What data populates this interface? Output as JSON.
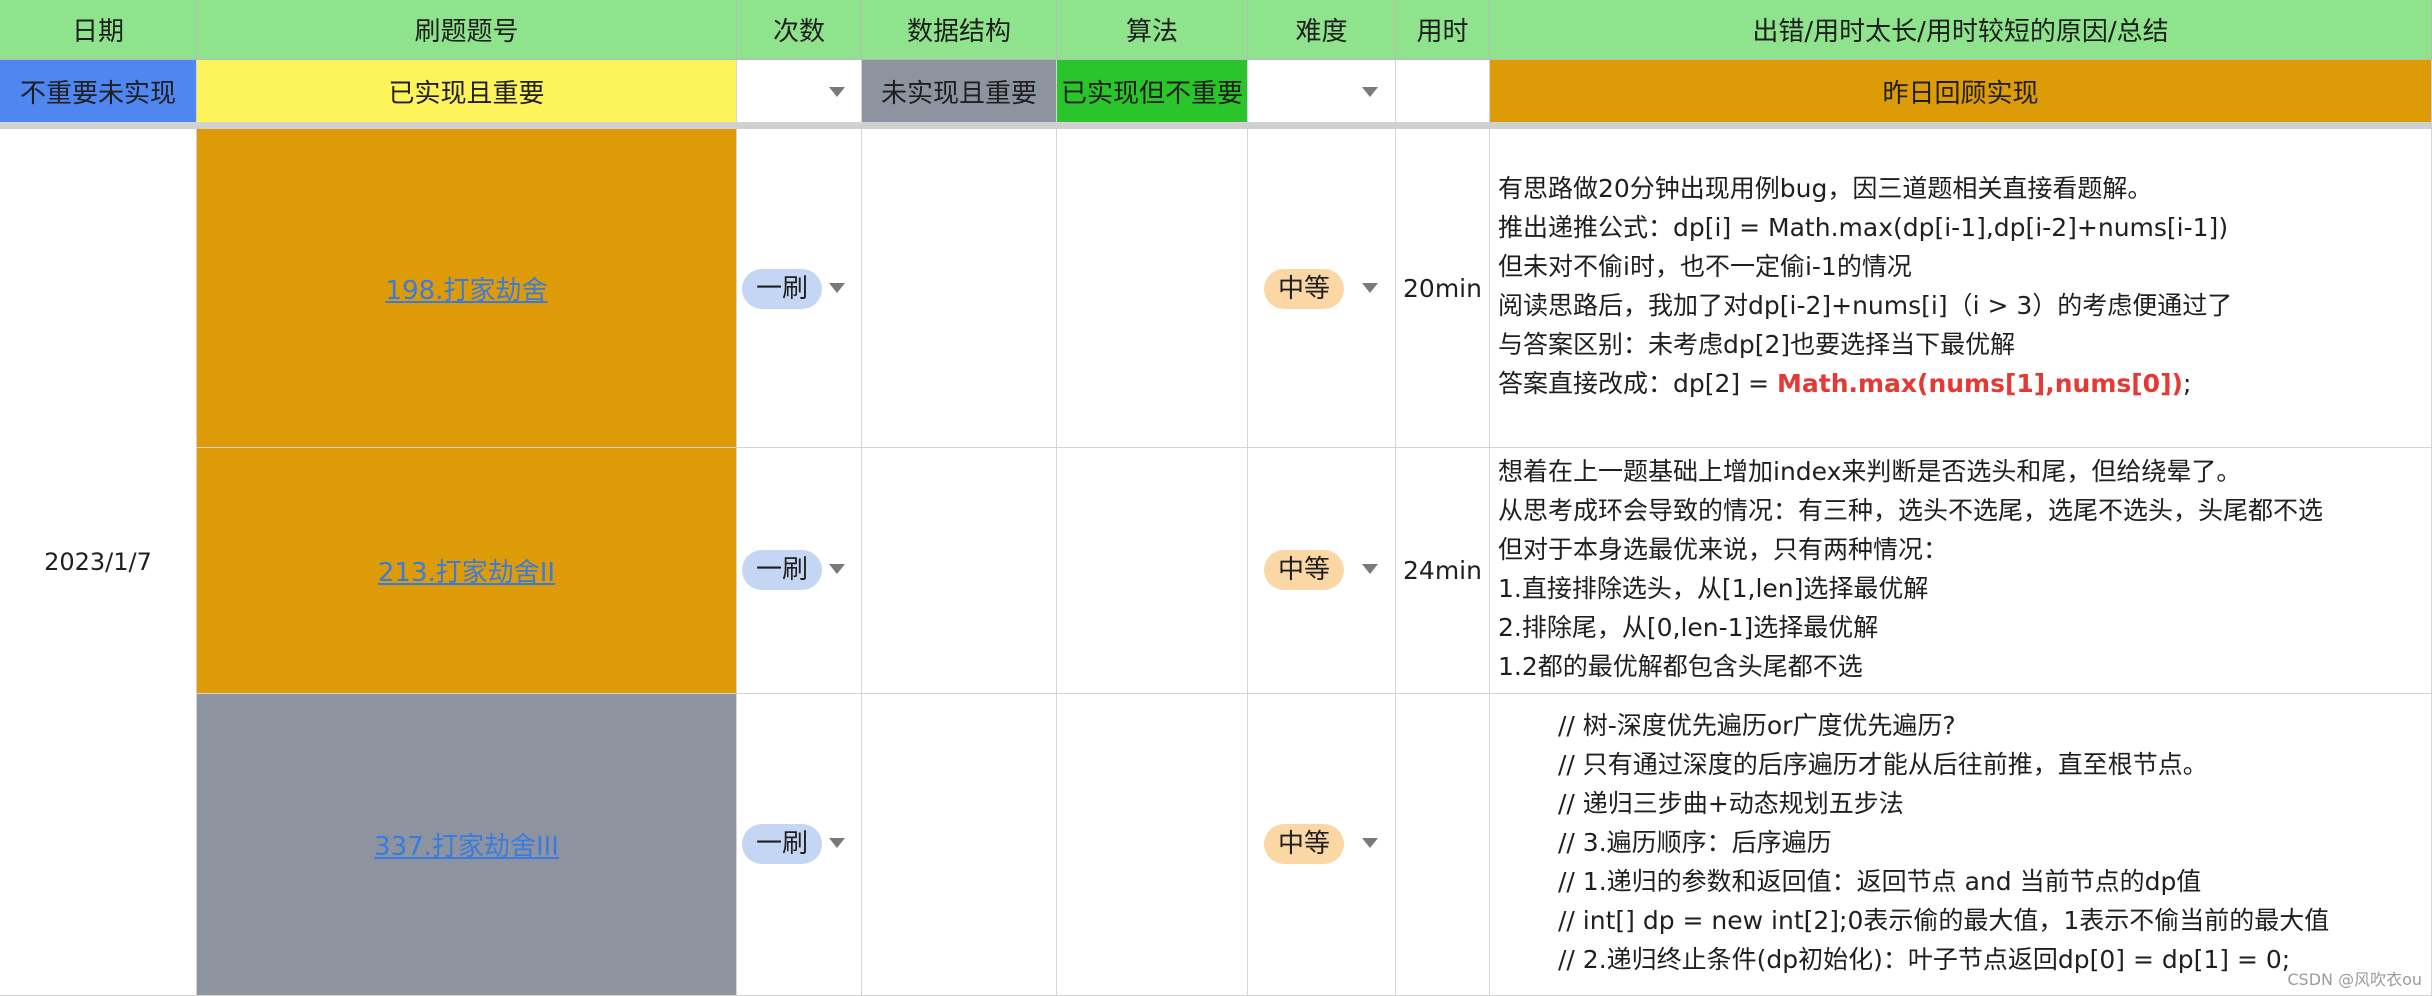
{
  "headers": {
    "date": "日期",
    "problem": "刷题题号",
    "count": "次数",
    "ds": "数据结构",
    "algo": "算法",
    "difficulty": "难度",
    "time": "用时",
    "summary": "出错/用时太长/用时较短的原因/总结"
  },
  "legend": {
    "not_important": "不重要未实现",
    "done_important": "已实现且重要",
    "not_done_important": "未实现且重要",
    "done_not_important": "已实现但不重要",
    "review": "昨日回顾实现"
  },
  "legend_colors": {
    "not_important": "#4f86f0",
    "done_important": "#fdf35a",
    "not_done_important": "#8d949f",
    "done_not_important": "#2ac52a",
    "review": "#dc9b07"
  },
  "date": "2023/1/7",
  "rows": [
    {
      "problem": "198.打家劫舍",
      "count": "一刷",
      "difficulty": "中等",
      "time": "20min",
      "color": "#dc9b07",
      "notes": [
        "有思路做20分钟出现用例bug，因三道题相关直接看题解。",
        "推出递推公式：dp[i] = Math.max(dp[i-1],dp[i-2]+nums[i-1])",
        "但未对不偷i时，也不一定偷i-1的情况",
        "阅读思路后，我加了对dp[i-2]+nums[i]（i > 3）的考虑便通过了",
        "与答案区别：未考虑dp[2]也要选择当下最优解"
      ],
      "last_prefix": "答案直接改成：dp[2] = ",
      "last_highlight": "Math.max(nums[1],nums[0])",
      "last_suffix": ";"
    },
    {
      "problem": "213.打家劫舍II",
      "count": "一刷",
      "difficulty": "中等",
      "time": "24min",
      "color": "#dc9b07",
      "notes": [
        "想着在上一题基础上增加index来判断是否选头和尾，但给绕晕了。",
        "从思考成环会导致的情况：有三种，选头不选尾，选尾不选头，头尾都不选",
        "但对于本身选最优来说，只有两种情况：",
        "1.直接排除选头，从[1,len]选择最优解",
        "2.排除尾，从[0,len-1]选择最优解",
        "1.2都的最优解都包含头尾都不选"
      ]
    },
    {
      "problem": "337.打家劫舍III",
      "count": "一刷",
      "difficulty": "中等",
      "time": "",
      "color": "#8d949f",
      "notes": [
        "// 树-深度优先遍历or广度优先遍历?",
        "// 只有通过深度的后序遍历才能从后往前推，直至根节点。",
        "// 递归三步曲+动态规划五步法",
        "// 3.遍历顺序：后序遍历",
        "// 1.递归的参数和返回值：返回节点 and 当前节点的dp值",
        "// int[] dp = new int[2];0表示偷的最大值，1表示不偷当前的最大值",
        "// 2.递归终止条件(dp初始化)：叶子节点返回dp[0] = dp[1] = 0;"
      ]
    }
  ],
  "watermark": "CSDN @风吹衣ou"
}
